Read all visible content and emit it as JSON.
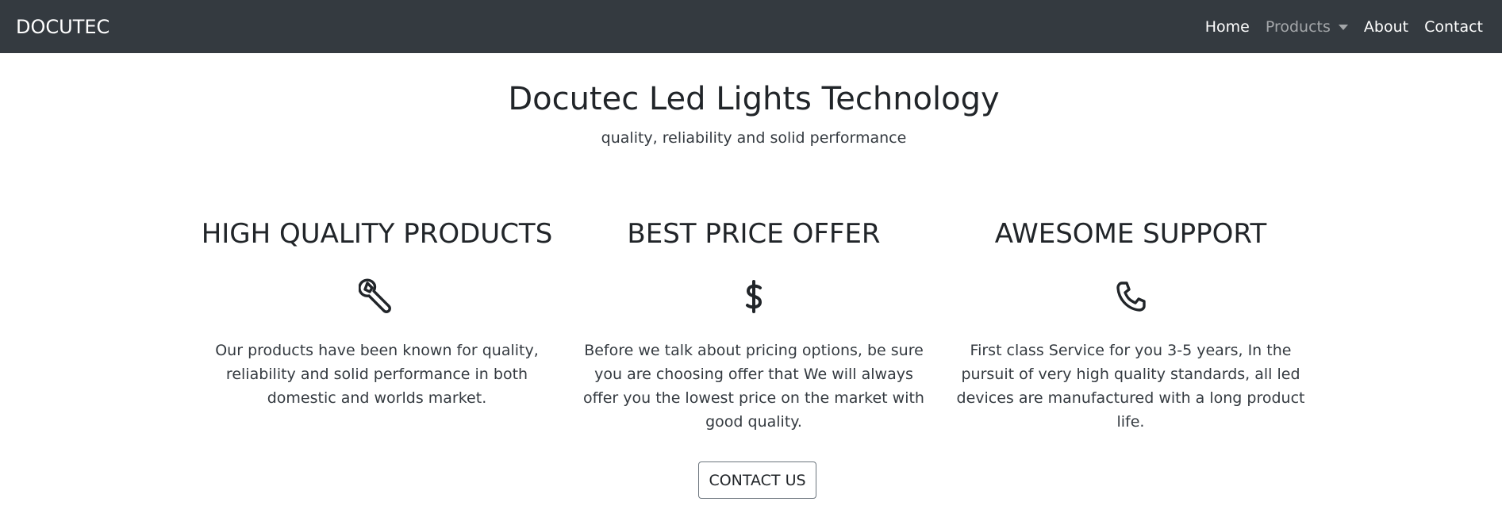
{
  "navbar": {
    "brand": "DOCUTEC",
    "links": [
      {
        "label": "Home"
      },
      {
        "label": "Products"
      },
      {
        "label": "About"
      },
      {
        "label": "Contact"
      }
    ]
  },
  "hero": {
    "title": "Docutec Led Lights Technology",
    "subtitle": "quality, reliability and solid performance"
  },
  "features": [
    {
      "title": "HIGH QUALITY PRODUCTS",
      "icon": "wrench-icon",
      "text": "Our products have been known for quality, reliability and solid performance in both domestic and worlds market."
    },
    {
      "title": "BEST PRICE OFFER",
      "icon": "dollar-icon",
      "text": "Before we talk about pricing options, be sure you are choosing offer that We will always offer you the lowest price on the market with good quality."
    },
    {
      "title": "AWESOME SUPPORT",
      "icon": "phone-icon",
      "text": "First class Service for you 3-5 years, In the pursuit of very high quality standards, all led devices are manufactured with a long product life."
    }
  ],
  "cta": {
    "label": "CONTACT US"
  },
  "colors": {
    "navbar_bg": "#343a40",
    "text": "#212529"
  }
}
